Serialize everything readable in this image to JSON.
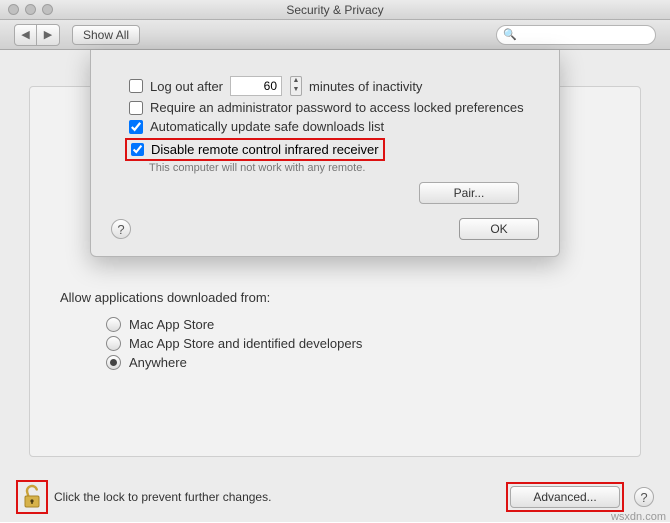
{
  "window": {
    "title": "Security & Privacy"
  },
  "toolbar": {
    "show_all": "Show All"
  },
  "sheet": {
    "logout_label_prefix": "Log out after",
    "logout_minutes": "60",
    "logout_label_suffix": "minutes of inactivity",
    "logout_checked": false,
    "require_admin_label": "Require an administrator password to access locked preferences",
    "require_admin_checked": false,
    "auto_update_label": "Automatically update safe downloads list",
    "auto_update_checked": true,
    "disable_ir_label": "Disable remote control infrared receiver",
    "disable_ir_checked": true,
    "ir_note": "This computer will not work with any remote.",
    "pair_button": "Pair...",
    "ok_button": "OK"
  },
  "allow": {
    "title": "Allow applications downloaded from:",
    "options": [
      {
        "label": "Mac App Store",
        "selected": false
      },
      {
        "label": "Mac App Store and identified developers",
        "selected": false
      },
      {
        "label": "Anywhere",
        "selected": true
      }
    ]
  },
  "bottom": {
    "lock_text": "Click the lock to prevent further changes.",
    "advanced_button": "Advanced..."
  },
  "watermark": "wsxdn.com"
}
